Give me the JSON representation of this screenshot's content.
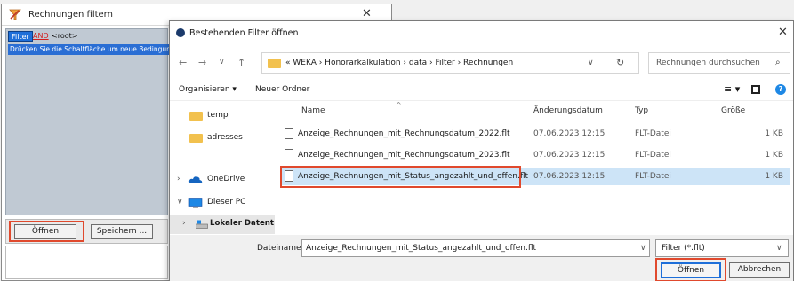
{
  "filter_window": {
    "title": "Rechnungen filtern",
    "close": "✕",
    "filter_chip": "Filter",
    "and_chip": "AND",
    "root_chip": "<root>",
    "hint": "Drücken Sie die Schaltfläche um neue Bedingung",
    "open_button": "Öffnen",
    "save_button": "Speichern ..."
  },
  "dialog": {
    "title": "Bestehenden Filter öffnen",
    "close": "✕",
    "nav": {
      "back": "←",
      "forward": "→",
      "recent": "∨",
      "up": "↑"
    },
    "path": "« WEKA › Honorarkalkulation › data › Filter › Rechnungen",
    "path_dropdown": "∨",
    "refresh": "↻",
    "search_placeholder": "Rechnungen durchsuchen",
    "search_icon": "⌕",
    "toolbar": {
      "organize": "Organisieren ▾",
      "new_folder": "Neuer Ordner",
      "view": "≡ ▾",
      "help": "?"
    },
    "sidebar": [
      {
        "label": "temp",
        "type": "folder"
      },
      {
        "label": "adresses",
        "type": "folder"
      },
      {
        "label": "OneDrive",
        "type": "cloud",
        "chevron": "›"
      },
      {
        "label": "Dieser PC",
        "type": "pc",
        "chevron": "∨"
      },
      {
        "label": "Lokaler Datent",
        "type": "drive",
        "chevron": "›"
      }
    ],
    "columns": {
      "name": "Name",
      "date": "Änderungsdatum",
      "type": "Typ",
      "size": "Größe"
    },
    "files": [
      {
        "name": "Anzeige_Rechnungen_mit_Rechnungsdatum_2022.flt",
        "date": "07.06.2023 12:15",
        "type": "FLT-Datei",
        "size": "1 KB"
      },
      {
        "name": "Anzeige_Rechnungen_mit_Rechnungsdatum_2023.flt",
        "date": "07.06.2023 12:15",
        "type": "FLT-Datei",
        "size": "1 KB"
      },
      {
        "name": "Anzeige_Rechnungen_mit_Status_angezahlt_und_offen.flt",
        "date": "07.06.2023 12:15",
        "type": "FLT-Datei",
        "size": "1 KB",
        "selected": true
      }
    ],
    "filename_label": "Dateiname:",
    "filename_value": "Anzeige_Rechnungen_mit_Status_angezahlt_und_offen.flt",
    "filetype_value": "Filter (*.flt)",
    "open_button": "Öffnen",
    "cancel_button": "Abbrechen",
    "dropdown": "∨"
  },
  "colors": {
    "highlight": "#e0492d",
    "selection": "#cde4f7",
    "accent": "#1e6fd9"
  }
}
